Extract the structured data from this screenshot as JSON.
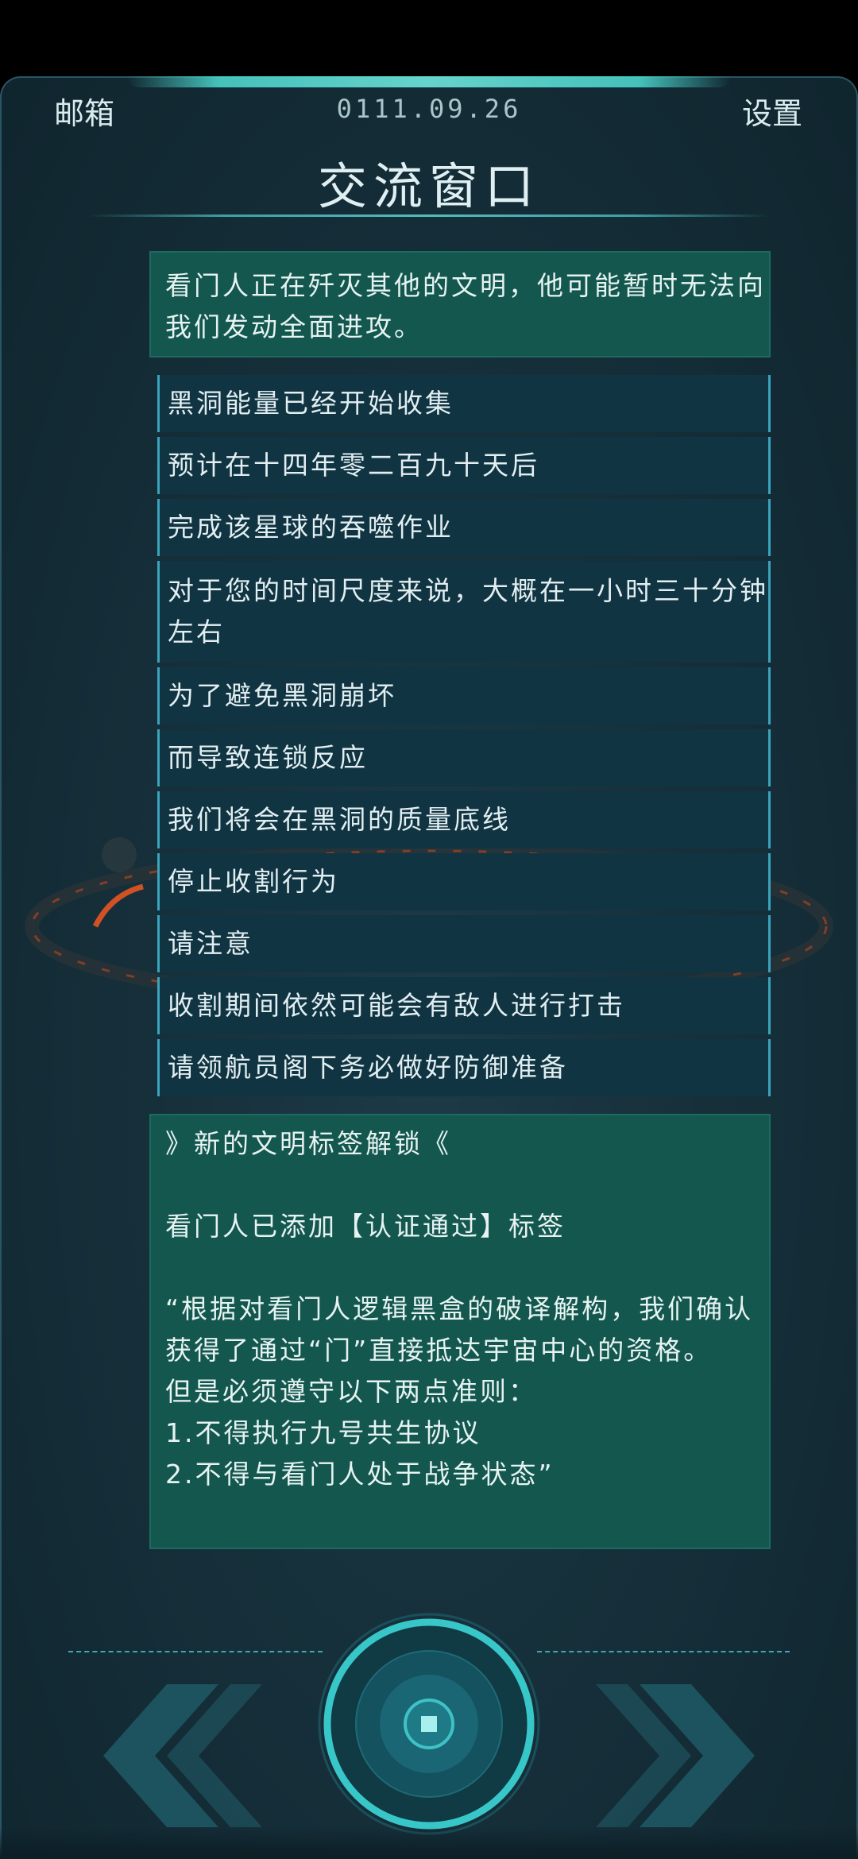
{
  "header": {
    "mail_label": "邮箱",
    "date": "0111.09.26",
    "settings_label": "设置"
  },
  "title": "交流窗口",
  "intro": "看门人正在歼灭其他的文明，他可能暂时无法向我们发动全面进攻。",
  "messages": [
    "黑洞能量已经开始收集",
    "预计在十四年零二百九十天后",
    "完成该星球的吞噬作业",
    "对于您的时间尺度来说，大概在一小时三十分钟左右",
    "为了避免黑洞崩坏",
    "而导致连锁反应",
    "我们将会在黑洞的质量底线",
    "停止收割行为",
    "请注意",
    "收割期间依然可能会有敌人进行打击",
    "请领航员阁下务必做好防御准备"
  ],
  "unlock": {
    "heading": "》新的文明标签解锁《",
    "added": "看门人已添加【认证通过】标签",
    "quote_line1": "“根据对看门人逻辑黑盒的破译解构，我们确认获得了通过“门”直接抵达宇宙中心的资格。",
    "quote_line2": "但是必须遵守以下两点准则：",
    "rule1": "1.不得执行九号共生协议",
    "rule2": "2.不得与看门人处于战争状态”"
  },
  "controls": {
    "prev_icon": "double-chevron-left-icon",
    "next_icon": "double-chevron-right-icon",
    "center_icon": "center-circle-button-icon"
  },
  "colors": {
    "panel_bg": "#16303b",
    "accent_teal": "#4ad2c9",
    "message_bg": "#103442",
    "highlight_bg": "#14574f"
  }
}
